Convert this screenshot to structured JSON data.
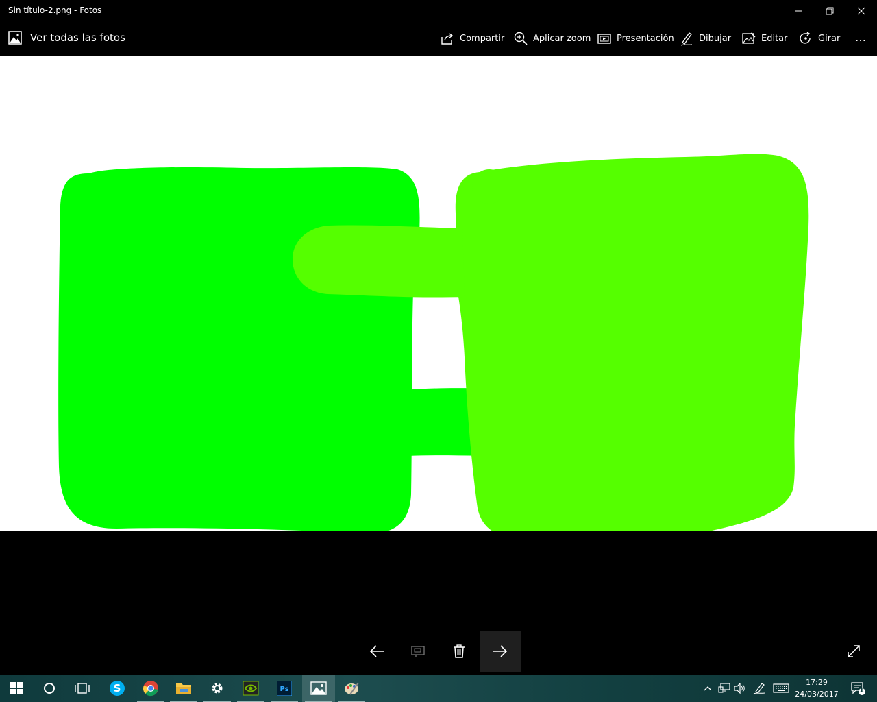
{
  "window": {
    "title": "Sin título-2.png - Fotos"
  },
  "toolbar": {
    "back_label": "Ver todas las fotos",
    "share": "Compartir",
    "zoom": "Aplicar zoom",
    "slideshow": "Presentación",
    "draw": "Dibujar",
    "edit": "Editar",
    "rotate": "Girar",
    "more": "…"
  },
  "image": {
    "colors": {
      "left_block": "#00ff00",
      "right_block": "#55ff00",
      "background": "#ffffff"
    }
  },
  "taskbar": {
    "time": "17:29",
    "date": "24/03/2017",
    "notification_count": "1",
    "accent_bg": "#123f40"
  }
}
